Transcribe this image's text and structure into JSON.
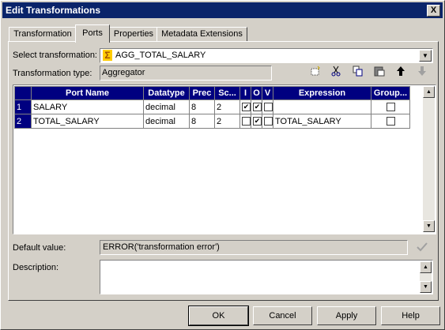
{
  "window": {
    "title": "Edit Transformations",
    "close_glyph": "X"
  },
  "tabs": [
    {
      "label": "Transformation",
      "active": false
    },
    {
      "label": "Ports",
      "active": true
    },
    {
      "label": "Properties",
      "active": false
    },
    {
      "label": "Metadata Extensions",
      "active": false
    }
  ],
  "select_transformation": {
    "label": "Select transformation:",
    "value": "AGG_TOTAL_SALARY",
    "icon": "sigma-icon"
  },
  "transformation_type": {
    "label": "Transformation type:",
    "value": "Aggregator"
  },
  "toolbar": [
    "new-port-icon",
    "cut-icon",
    "copy-icon",
    "paste-icon",
    "move-up-icon",
    "move-down-icon"
  ],
  "ports_table": {
    "columns": [
      "Port Name",
      "Datatype",
      "Prec",
      "Sc...",
      "I",
      "O",
      "V",
      "Expression",
      "Group..."
    ],
    "rows": [
      {
        "num": "1",
        "port_name": "SALARY",
        "datatype": "decimal",
        "prec": "8",
        "scale": "2",
        "input": true,
        "output": true,
        "variable": false,
        "expression": "",
        "group_by": false
      },
      {
        "num": "2",
        "port_name": "TOTAL_SALARY",
        "datatype": "decimal",
        "prec": "8",
        "scale": "2",
        "input": false,
        "output": true,
        "variable": false,
        "expression": "TOTAL_SALARY",
        "group_by": false
      }
    ]
  },
  "default_value": {
    "label": "Default value:",
    "value": "ERROR('transformation error')"
  },
  "description": {
    "label": "Description:",
    "value": ""
  },
  "buttons": {
    "ok": "OK",
    "cancel": "Cancel",
    "apply": "Apply",
    "help": "Help"
  },
  "colors": {
    "title_bar": "#0a246a",
    "grid_header": "#000080",
    "face": "#d4d0c8"
  }
}
